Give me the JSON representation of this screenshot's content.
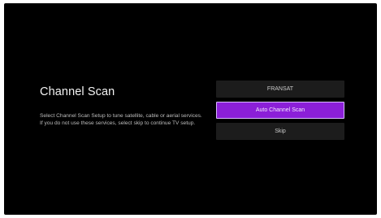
{
  "screen": {
    "title": "Channel Scan",
    "description": "Select Channel Scan Setup to tune satellite, cable or aerial services. If you do not use these services, select skip to continue TV setup."
  },
  "menu": {
    "items": [
      {
        "label": "FRANSAT",
        "selected": false
      },
      {
        "label": "Auto Channel Scan",
        "selected": true
      },
      {
        "label": "Skip",
        "selected": false
      }
    ]
  },
  "colors": {
    "background": "#000000",
    "item_background": "#1c1c1c",
    "accent": "#8b1fd8"
  }
}
